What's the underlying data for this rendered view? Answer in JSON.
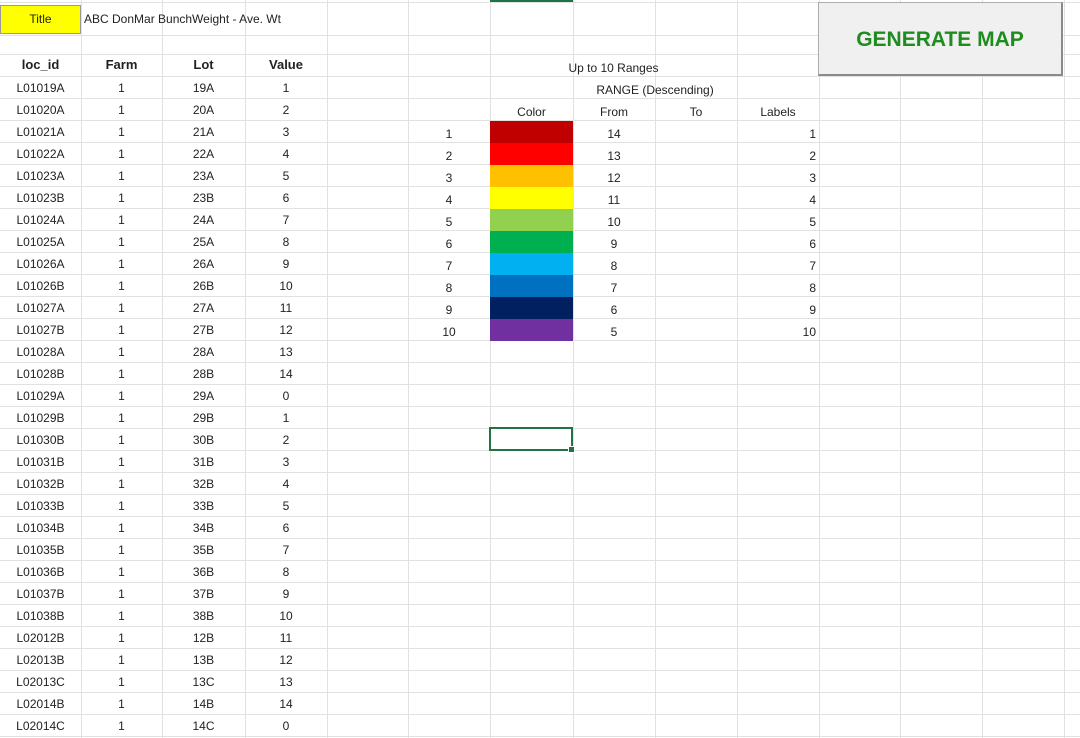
{
  "title": {
    "label": "Title",
    "value": "ABC DonMar BunchWeight - Ave. Wt"
  },
  "generate_button": {
    "label": "GENERATE MAP"
  },
  "table": {
    "headers": [
      "loc_id",
      "Farm",
      "Lot",
      "Value"
    ],
    "rows": [
      [
        "L01019A",
        "1",
        "19A",
        "1"
      ],
      [
        "L01020A",
        "1",
        "20A",
        "2"
      ],
      [
        "L01021A",
        "1",
        "21A",
        "3"
      ],
      [
        "L01022A",
        "1",
        "22A",
        "4"
      ],
      [
        "L01023A",
        "1",
        "23A",
        "5"
      ],
      [
        "L01023B",
        "1",
        "23B",
        "6"
      ],
      [
        "L01024A",
        "1",
        "24A",
        "7"
      ],
      [
        "L01025A",
        "1",
        "25A",
        "8"
      ],
      [
        "L01026A",
        "1",
        "26A",
        "9"
      ],
      [
        "L01026B",
        "1",
        "26B",
        "10"
      ],
      [
        "L01027A",
        "1",
        "27A",
        "11"
      ],
      [
        "L01027B",
        "1",
        "27B",
        "12"
      ],
      [
        "L01028A",
        "1",
        "28A",
        "13"
      ],
      [
        "L01028B",
        "1",
        "28B",
        "14"
      ],
      [
        "L01029A",
        "1",
        "29A",
        "0"
      ],
      [
        "L01029B",
        "1",
        "29B",
        "1"
      ],
      [
        "L01030B",
        "1",
        "30B",
        "2"
      ],
      [
        "L01031B",
        "1",
        "31B",
        "3"
      ],
      [
        "L01032B",
        "1",
        "32B",
        "4"
      ],
      [
        "L01033B",
        "1",
        "33B",
        "5"
      ],
      [
        "L01034B",
        "1",
        "34B",
        "6"
      ],
      [
        "L01035B",
        "1",
        "35B",
        "7"
      ],
      [
        "L01036B",
        "1",
        "36B",
        "8"
      ],
      [
        "L01037B",
        "1",
        "37B",
        "9"
      ],
      [
        "L01038B",
        "1",
        "38B",
        "10"
      ],
      [
        "L02012B",
        "1",
        "12B",
        "11"
      ],
      [
        "L02013B",
        "1",
        "13B",
        "12"
      ],
      [
        "L02013C",
        "1",
        "13C",
        "13"
      ],
      [
        "L02014B",
        "1",
        "14B",
        "14"
      ],
      [
        "L02014C",
        "1",
        "14C",
        "0"
      ]
    ]
  },
  "ranges": {
    "heading": "Up to 10 Ranges",
    "subheading": "RANGE (Descending)",
    "col_color": "Color",
    "col_from": "From",
    "col_to": "To",
    "col_labels": "Labels",
    "items": [
      {
        "index": "1",
        "color": "#c00000",
        "from": "14",
        "to": "",
        "label": "1"
      },
      {
        "index": "2",
        "color": "#ff0000",
        "from": "13",
        "to": "",
        "label": "2"
      },
      {
        "index": "3",
        "color": "#ffc000",
        "from": "12",
        "to": "",
        "label": "3"
      },
      {
        "index": "4",
        "color": "#ffff00",
        "from": "11",
        "to": "",
        "label": "4"
      },
      {
        "index": "5",
        "color": "#92d050",
        "from": "10",
        "to": "",
        "label": "5"
      },
      {
        "index": "6",
        "color": "#00b050",
        "from": "9",
        "to": "",
        "label": "6"
      },
      {
        "index": "7",
        "color": "#00b0f0",
        "from": "8",
        "to": "",
        "label": "7"
      },
      {
        "index": "8",
        "color": "#0070c0",
        "from": "7",
        "to": "",
        "label": "8"
      },
      {
        "index": "9",
        "color": "#002060",
        "from": "6",
        "to": "",
        "label": "9"
      },
      {
        "index": "10",
        "color": "#7030a0",
        "from": "5",
        "to": "",
        "label": "10"
      }
    ]
  },
  "colors": {
    "selection": "#217346",
    "button_text": "#1e8c1e",
    "title_fill": "#ffff00"
  }
}
